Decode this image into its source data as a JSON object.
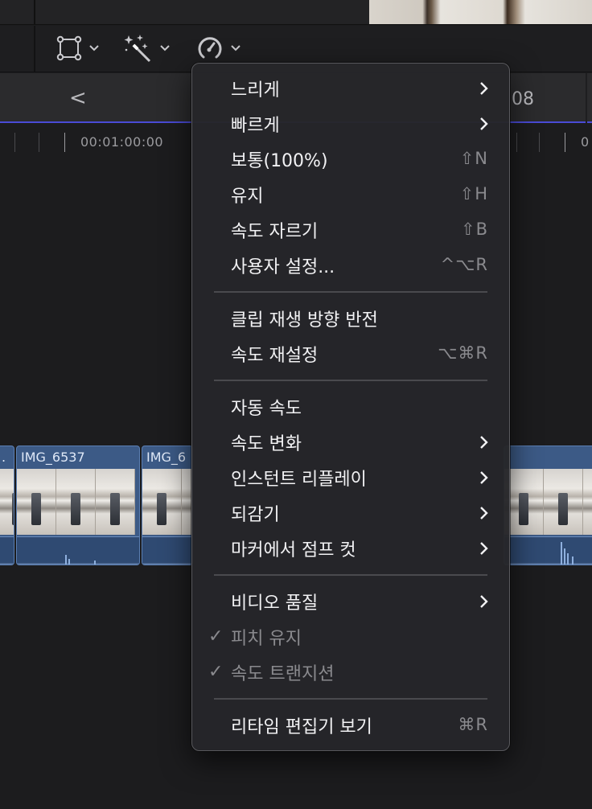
{
  "toolbar": {
    "tools": [
      {
        "name": "transform",
        "icon": "transform-icon"
      },
      {
        "name": "enhance",
        "icon": "magic-wand-icon"
      },
      {
        "name": "retime",
        "icon": "speedometer-icon"
      }
    ]
  },
  "timeline": {
    "nav_back_glyph": "<",
    "right_timecode": "08",
    "ruler_timecode": "00:01:00:00",
    "ruler_timecode_right": "0",
    "clips": [
      {
        "label": "."
      },
      {
        "label": "IMG_6537"
      },
      {
        "label": "IMG_6"
      },
      {
        "label": ""
      }
    ]
  },
  "retime_menu": {
    "sections": [
      {
        "items": [
          {
            "label": "느리게",
            "submenu": true
          },
          {
            "label": "빠르게",
            "submenu": true
          },
          {
            "label": "보통(100%)",
            "shortcut": "⇧N"
          },
          {
            "label": "유지",
            "shortcut": "⇧H"
          },
          {
            "label": "속도 자르기",
            "shortcut": "⇧B"
          },
          {
            "label": "사용자 설정...",
            "shortcut": "^⌥R"
          }
        ]
      },
      {
        "items": [
          {
            "label": "클립 재생 방향 반전"
          },
          {
            "label": "속도 재설정",
            "shortcut": "⌥⌘R"
          }
        ]
      },
      {
        "items": [
          {
            "label": "자동 속도"
          },
          {
            "label": "속도 변화",
            "submenu": true
          },
          {
            "label": "인스턴트 리플레이",
            "submenu": true
          },
          {
            "label": "되감기",
            "submenu": true
          },
          {
            "label": "마커에서 점프 컷",
            "submenu": true
          }
        ]
      },
      {
        "items": [
          {
            "label": "비디오 품질",
            "submenu": true
          },
          {
            "label": "피치 유지",
            "checked": true,
            "disabled": true
          },
          {
            "label": "속도 트랜지션",
            "checked": true,
            "disabled": true
          }
        ]
      },
      {
        "items": [
          {
            "label": "리타임 편집기 보기",
            "shortcut": "⌘R"
          }
        ]
      }
    ],
    "check_glyph": "✓"
  },
  "colors": {
    "menu_bg": "#262629",
    "clip_blue": "#3c5a86",
    "playhead_line": "#4a4bd6"
  }
}
